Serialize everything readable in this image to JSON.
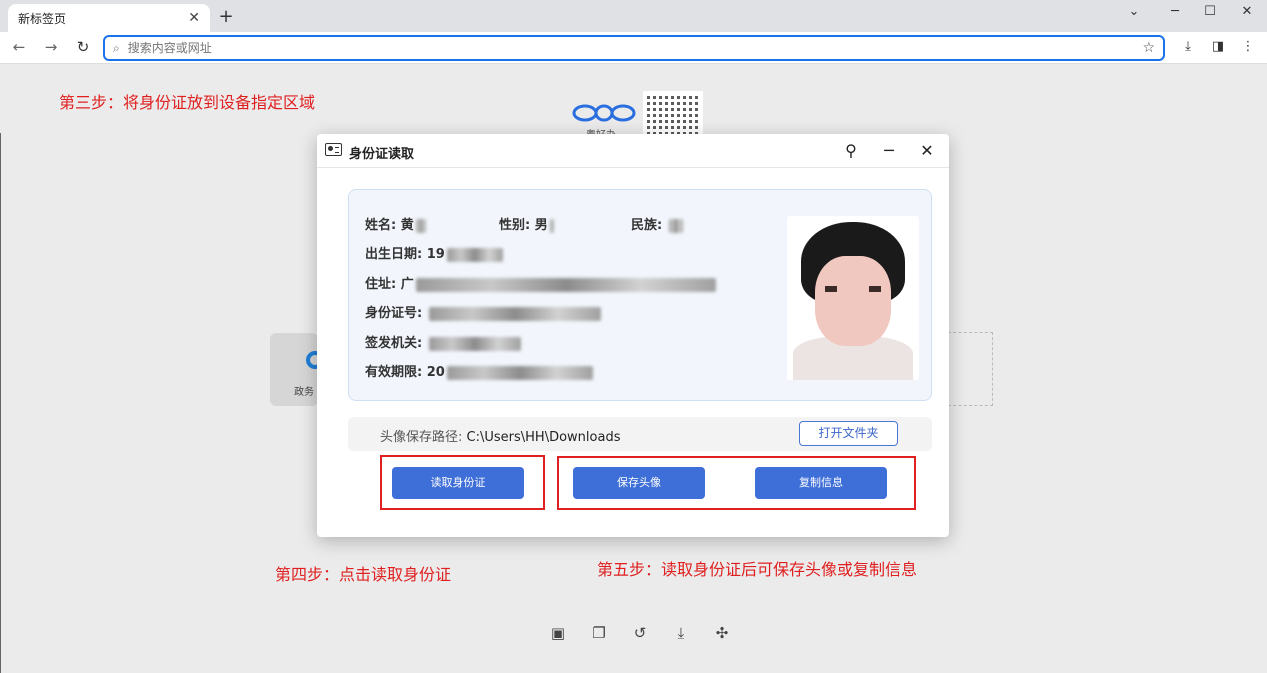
{
  "browser": {
    "tab_title": "新标签页",
    "tab_close": "✕",
    "new_tab": "+",
    "address_placeholder": "搜索内容或网址"
  },
  "annotations": {
    "step3": "第三步：将身份证放到设备指定区域",
    "step4": "第四步：点击读取身份证",
    "step5": "第五步：读取身份证后可保存头像或复制信息"
  },
  "page": {
    "logo_text": "粤好办",
    "shortcut_label": "政务"
  },
  "dialog": {
    "title": "身份证读取",
    "fields": {
      "name_label": "姓名:",
      "name_value": "黄",
      "gender_label": "性别:",
      "gender_value": "男",
      "ethnicity_label": "民族:",
      "birth_label": "出生日期:",
      "birth_value": "19",
      "address_label": "住址:",
      "address_value": "广",
      "id_label": "身份证号:",
      "issuer_label": "签发机关:",
      "validity_label": "有效期限:",
      "validity_value": "20"
    },
    "save_path_label": "头像保存路径:",
    "save_path_value": "C:\\Users\\HH\\Downloads",
    "open_folder": "打开文件夹",
    "read_id": "读取身份证",
    "save_avatar": "保存头像",
    "copy_info": "复制信息"
  },
  "colors": {
    "annotation": "#e02020",
    "primary": "#3e6ed7",
    "address_focus": "#1a73e8"
  }
}
